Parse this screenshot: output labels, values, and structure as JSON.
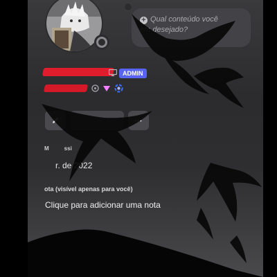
{
  "status_bubble": {
    "text_line1": "Qual conteúdo você",
    "text_line2": "em desejado?"
  },
  "profile": {
    "role_badge": "ADMIN",
    "member_since_label": "M",
    "member_since_partial": "ssi",
    "member_since_date": "r. de 2022"
  },
  "note": {
    "label": "ota (visível apenas para você)",
    "placeholder": "Clique para adicionar uma nota"
  },
  "actions": {
    "more_label": "•••"
  },
  "colors": {
    "admin_badge": "#5865f2",
    "redaction": "#e01d2c",
    "panel_bg": "#2e2e30"
  },
  "icons": [
    "plus-circle-icon",
    "monitor-icon",
    "edit-pencil-icon",
    "more-dots-icon",
    "status-ring-icon",
    "nitro-badge-icon",
    "boost-badge-icon",
    "gem-badge-icon"
  ]
}
